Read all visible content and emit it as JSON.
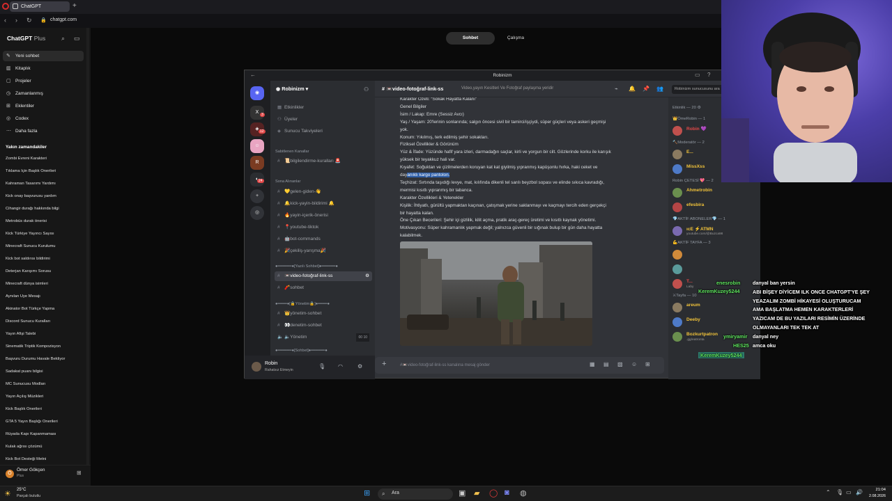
{
  "browser": {
    "tab_title": "ChatGPT",
    "url": "chatgpt.com",
    "new_tab_glyph": "+",
    "back_glyph": "‹",
    "forward_glyph": "›",
    "reload_glyph": "↻"
  },
  "gpt": {
    "brand": "ChatGPT",
    "brand_plan": "Plus",
    "nav": [
      {
        "label": "Yeni sohbet",
        "icon": "edit-icon"
      },
      {
        "label": "Kitaplık",
        "icon": "library-icon"
      },
      {
        "label": "Projeler",
        "icon": "folder-icon"
      },
      {
        "label": "Zamanlanmış",
        "icon": "clock-icon"
      },
      {
        "label": "Eklentiler",
        "icon": "apps-icon"
      },
      {
        "label": "Codex",
        "icon": "codex-icon"
      },
      {
        "label": "Daha fazla",
        "icon": "more-icon"
      }
    ],
    "recent_header": "Yakın zamandakiler",
    "recent": [
      "Zombi Evreni Karakteri",
      "Tıklama İçin Başlık Önerileri",
      "Kahraman Tasarımı Yardımı",
      "Kick onay başvurusu yardım",
      "Cihangir durağı hakkında bilgi",
      "Metrobüs durak önerisi",
      "Kick Türkiye Yayıncı Sayısı",
      "Minecraft Sunucu Kurulumu",
      "Kick bot saldırısı bildirimi",
      "Deterjan Karışımı Sorusu",
      "Minecraft dünya isimleri",
      "Aynılan Üye Mesajı",
      "Akinator Bot Türkçe Yapma",
      "Discord Sunucu Kuralları",
      "Yayın Afişi Talebi",
      "Sinematik Triptik Kompozisyon",
      "Başvuru Durumu Havale Bekliyor",
      "Sadakat puanı bilgisi",
      "MC Sunucusu Modları",
      "Yayın Açılış Müzikleri",
      "Kick Başlık Önerileri",
      "GTA 5 Yayın Başlığı Önerileri",
      "Rüyada Kapı Kapanmaması",
      "Kulak ağrısı çözümü",
      "Kick Bot Desteği Metni"
    ],
    "user_name": "Ömer Gökçen",
    "user_plan": "Plus",
    "user_initial": "Ö",
    "toggle_active": "Sohbet",
    "toggle_other": "Çalışma"
  },
  "discord": {
    "window_title": "Robinizm",
    "server_name": "Robinizm",
    "channel_name": "video-fotoğraf-link-ss",
    "channel_topic": "Video,yayın Kesitleri Ve Fotoğraf paylaşma yeridir",
    "search_placeholder": "Robinizm sunucusunu ara",
    "server_badges": [
      "3",
      "12",
      "24"
    ],
    "top_items": [
      "Etkinlikler",
      "Üyeler",
      "Sunucu Takviyeleri"
    ],
    "categories": {
      "pinned": "Sabitlenen Kanallar",
      "recent": "Sona Alınanlar",
      "yazili": "●━━━━━━●[Yazılı Sohbet]●━━━━━━●",
      "yonetim": "●━━━━●[🔒Yönetim🔒]●━━━━●",
      "sohbet": "●━━━━━━●[Sohbet]●━━━━━━●"
    },
    "channels_pinned": [
      "📜bilgilendirme-kuralları 🚨"
    ],
    "channels_recent": [
      "💛gelen-giden-👋",
      "🔔kick-yayin-bildirimi 🔔",
      "🔥yayin-içerik-önerisi",
      "📍youtube-tiktok",
      "🤖bot-commands",
      "🎉çekiliş-yarışma🎉"
    ],
    "channels_yazili": [
      "📼video-fotoğraf-link-ss",
      "🧨sohbet"
    ],
    "channels_yonetim": [
      "👑yönetim-sohbet",
      "👀denetim-sohbet",
      "🔈Yönetim"
    ],
    "voice_counts": [
      "00",
      "10"
    ],
    "user_name": "Robin",
    "user_status": "Rahatsız Etmeyin",
    "message_lines": [
      "Karakter Özeti: “Sokak Hayatta Kalanı”",
      "Genel Bilgiler",
      "İsim / Lakap: Emre (Sessiz Avcı)",
      "Yaş / Yaşam: 20'lerinin sonlarında; salgın öncesi sivil bir tamirci/işçiydi, süper güçleri veya askeri geçmişi",
      "yok.",
      "Konum: Yıkılmış, terk edilmiş şehir sokakları.",
      "Fiziksel Özellikler & Görünüm",
      "Yüz & İfade: Yüzünde hafif yara izleri, darmadağın saçlar, kirli ve yorgun bir cilt. Gözlerinde korku ile karışık",
      "yüksek bir teyakkuz hali var.",
      "Kıyafet: Soğuktan ve çizilmelerden koruyan kat kat giyilmiş yıpranmış kapüşonlu hırka, haki ceket ve"
    ],
    "line10_pre": "day",
    "line10_hl": "anıklı kargo pantolon.",
    "message_lines_after": [
      "Teçhizat: Sırtında taşıdığı levye, mat, kılıfında dikenli tel sarılı beyzbol sopası ve elinde sıkıca kavradığı,",
      "mermisi kısıtlı yıpranmış bir tabanca.",
      "Karakter Özellikleri & Yetenekler",
      "Kişilik: İhtiyatlı, gürültü yapmaktan kaçınan, çatışmak yerine saklanmayı ve kaçmayı tercih eden gerçekçi",
      "bir hayatta kalan.",
      "Öne Çıkan Becerileri: Şehir içi gizlilik, kilit açma, pratik araç-gereç üretimi ve kısıtlı kaynak yönetimi.",
      "Motivasyonu: Süper kahramanlık yapmak değil; yalnızca güvenli bir sığınak bulup bir gün daha hayatta",
      "kalabilmek."
    ],
    "input_placeholder": "#📼video-fotoğraf-link-ss kanalına mesaj gönder",
    "members": {
      "activity_header": "Etkinlik — 20 ⚙",
      "groups": [
        {
          "header": "👑ÖmeRobin — 1",
          "members": [
            {
              "name": "Robin 💜",
              "color": "#e34848",
              "sub": ""
            }
          ]
        },
        {
          "header": "🔨Moderatör — 2",
          "members": [
            {
              "name": "E...",
              "color": "#f0c23a",
              "sub": ""
            },
            {
              "name": "MissXss",
              "color": "#f0c23a",
              "sub": ""
            }
          ]
        },
        {
          "header": "Robin ÇETESİ 💖 — 2",
          "members": [
            {
              "name": "Ahmetrobin",
              "color": "#f0c23a",
              "sub": ""
            },
            {
              "name": "efesbira",
              "color": "#f0c23a",
              "sub": ""
            }
          ]
        },
        {
          "header": "💎AKTİF ABONELER💎 — 1",
          "members": [
            {
              "name": "ıcE ⚡ATMN",
              "color": "#f0c23a",
              "sub": "youtube.com/@Buzca98"
            }
          ]
        },
        {
          "header": "💪AKTİF TAYFA — 3",
          "members": [
            {
              "name": "",
              "color": "#f0c23a",
              "sub": ""
            },
            {
              "name": "",
              "color": "#f0c23a",
              "sub": ""
            },
            {
              "name": "T...",
              "color": "#e34848",
              "sub": "Laby"
            }
          ]
        },
        {
          "header": "⚔Tayfa — 10",
          "members": [
            {
              "name": "areum",
              "color": "#f0c23a",
              "sub": ""
            },
            {
              "name": "Deeby",
              "color": "#f0c23a",
              "sub": ""
            },
            {
              "name": "Bozkurtpatron",
              "color": "#f0c23a",
              "sub": ".gg/eatronta"
            }
          ]
        }
      ]
    }
  },
  "stream_chat": [
    {
      "user": "enesrobin",
      "text": "danyal ban yersin"
    },
    {
      "user": "",
      "text": "ABI BİŞEY DİYİCEM ILK ONCE CHATGPT'YE ŞEY"
    },
    {
      "user": "KeremKuzey5244",
      "text": "YEAZALIM ZOMBİ HİKAYESİ OLUŞTURUCAM"
    },
    {
      "user": "",
      "text": "AMA BAŞLATMA HEMEN KARAKTERLERİ"
    },
    {
      "user": "",
      "text": "YAZICAM DE BU YAZILARI RESİMİN ÜZERİNDE"
    },
    {
      "user": "",
      "text": "OLMAYANLARI TEK TEK AT"
    },
    {
      "user": "ymiryamir",
      "text": "danyal ney"
    },
    {
      "user": "HES25",
      "text": "amca oku"
    },
    {
      "user": "KeremKuzey5244",
      "text": ""
    }
  ],
  "taskbar": {
    "temp": "25°C",
    "weather": "Parçalı bulutlu",
    "search_label": "Ara",
    "time": "21:04",
    "date": "2.08.2026"
  },
  "colors": {
    "discord_bg": "#313338",
    "discord_sidebar": "#2b2d31",
    "discord_dark": "#1e1f22",
    "highlight": "#2f5fa8",
    "webcam_bg": "#5a48c4"
  }
}
